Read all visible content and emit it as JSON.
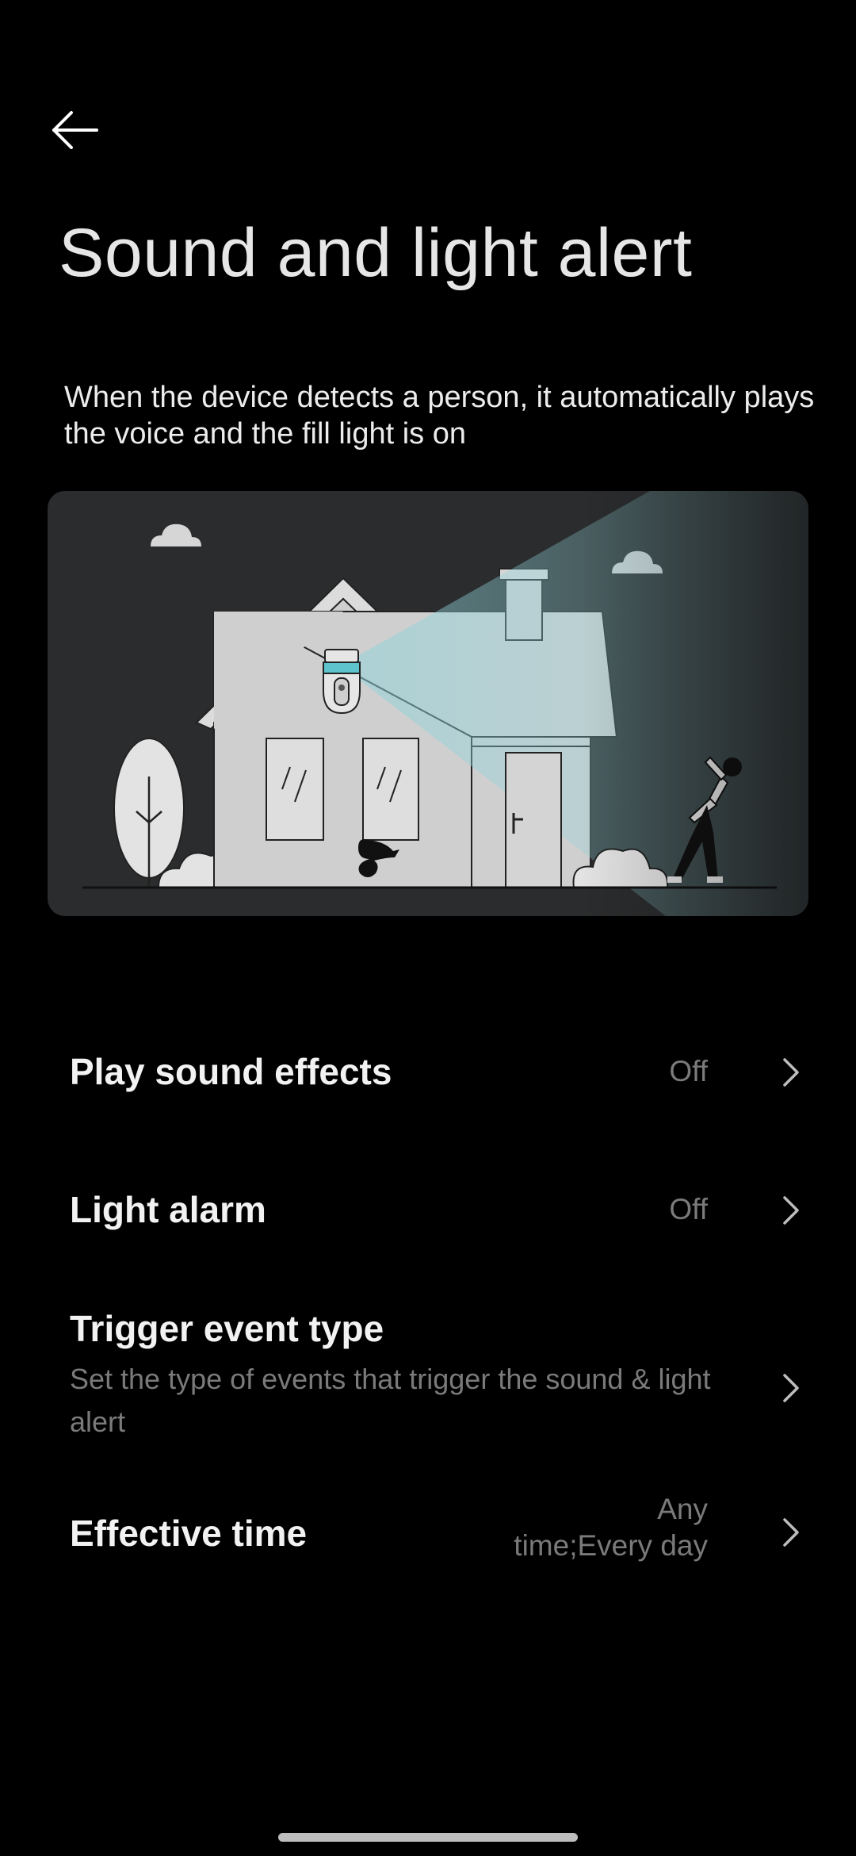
{
  "header": {
    "back_icon": "arrow-left-icon",
    "title": "Sound and light alert"
  },
  "description": "When the device detects a person, it automatically plays the voice and the fill light is on",
  "illustration": {
    "icon": "house-camera-person-illustration"
  },
  "settings": {
    "play_sound": {
      "label": "Play sound effects",
      "value": "Off"
    },
    "light_alarm": {
      "label": "Light alarm",
      "value": "Off"
    },
    "trigger_event": {
      "label": "Trigger event type",
      "subtitle": "Set the type of events that trigger the sound & light alert"
    },
    "effective_time": {
      "label": "Effective time",
      "value_line1": "Any",
      "value_line2": "time;Every day"
    }
  },
  "colors": {
    "background": "#000000",
    "card": "#2b2c2d",
    "secondary_text": "#7a7a7a",
    "accent_teal": "#5ec3cc"
  }
}
